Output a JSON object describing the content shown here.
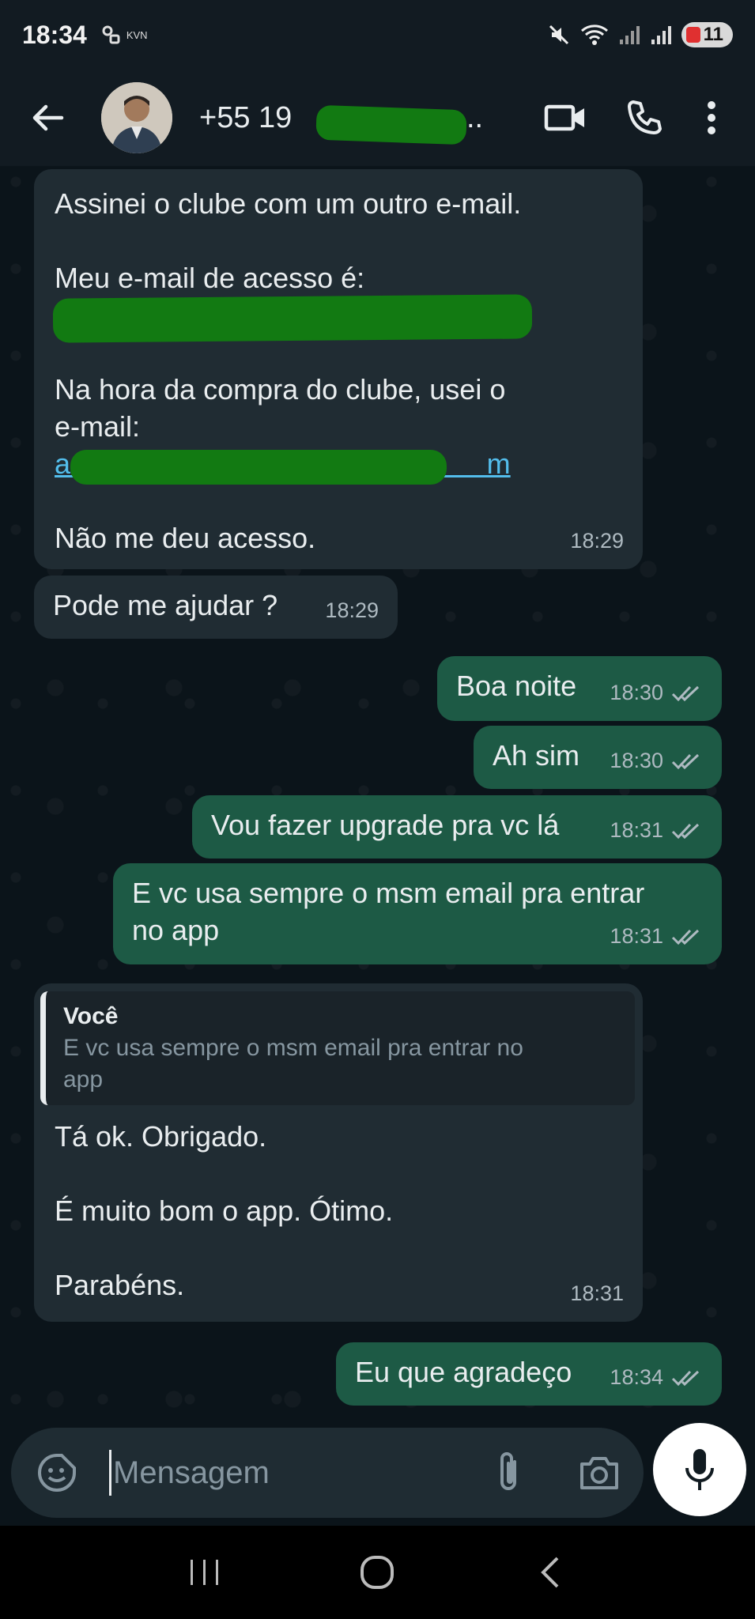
{
  "status_bar": {
    "time": "18:34",
    "left_indicator": "KVN",
    "battery_level": "11",
    "icons": [
      "key-icon",
      "mute-icon",
      "wifi-icon",
      "signal-icon",
      "signal-icon",
      "battery-icon"
    ]
  },
  "header": {
    "contact_name": "+55 19 ••••••••••…",
    "contact_visible_prefix": "+55 19",
    "icons": [
      "back-arrow-icon",
      "video-call-icon",
      "voice-call-icon",
      "more-vert-icon"
    ]
  },
  "messages": [
    {
      "direction": "in",
      "lines": [
        "Assinei o clube com um outro e-mail.",
        "",
        "Meu e-mail de acesso é:",
        "",
        "",
        "Na hora da compra do clube, usei o",
        "e-mail:",
        "a                             @                    m",
        "",
        "Não me deu acesso."
      ],
      "time": "18:29"
    },
    {
      "direction": "in",
      "text": "Pode me ajudar ?",
      "time": "18:29"
    },
    {
      "direction": "out",
      "text": "Boa noite",
      "time": "18:30"
    },
    {
      "direction": "out",
      "text": "Ah sim",
      "time": "18:30"
    },
    {
      "direction": "out",
      "text": "Vou fazer upgrade pra vc lá",
      "time": "18:31"
    },
    {
      "direction": "out",
      "lines": [
        "E vc usa sempre o msm email pra entrar",
        "no app"
      ],
      "time": "18:31"
    },
    {
      "direction": "in",
      "quote": {
        "author": "Você",
        "lines": [
          "E vc usa sempre o msm email pra entrar no",
          "app"
        ]
      },
      "lines": [
        "Tá ok. Obrigado.",
        "",
        "É muito bom o app. Ótimo.",
        "",
        "Parabéns."
      ],
      "time": "18:31"
    },
    {
      "direction": "out",
      "text": "Eu que agradeço",
      "time": "18:34"
    }
  ],
  "input": {
    "placeholder": "Mensagem",
    "icons": [
      "emoji-sticker-icon",
      "attach-clip-icon",
      "camera-icon",
      "mic-icon"
    ]
  },
  "colors": {
    "background": "#0b141a",
    "incoming": "#202c33",
    "outgoing": "#1d5a45",
    "link": "#53bdeb",
    "redaction": "#127a12"
  }
}
